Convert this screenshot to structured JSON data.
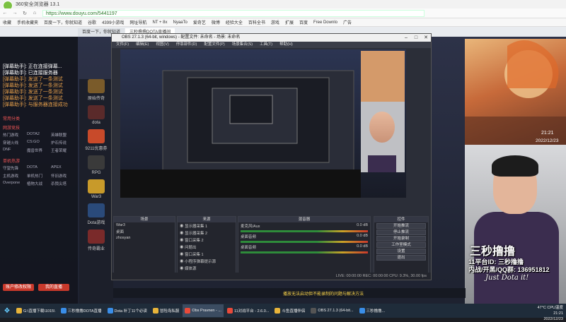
{
  "browser": {
    "title": "360安全浏览器 13.1",
    "url": "https://www.douyu.com/5441197",
    "bookmarks": [
      "收藏",
      "手机收藏夹",
      "百度一下，你就知道",
      "谷歌",
      "4399小游戏",
      "网址导航",
      "NT + 8x",
      "NyaaTo",
      "爱奇艺",
      "微博",
      "经验大全",
      "百科全书",
      "游戏",
      "扩展",
      "百度",
      "Free Downlo",
      "广告"
    ],
    "tabs": [
      {
        "label": "百度一下，你就知道",
        "active": false
      },
      {
        "label": "三秒撸撸DOTA直播间",
        "active": true
      }
    ]
  },
  "chat": {
    "lines": [
      {
        "text": "[弹幕助手]: 正在连接弹幕...",
        "white": true
      },
      {
        "text": "[弹幕助手]: 已连接服务器",
        "white": true
      },
      {
        "text": "[弹幕助手]: 发送了一条测试",
        "white": false
      },
      {
        "text": "[弹幕助手]: 发送了一条测试",
        "white": false
      },
      {
        "text": "[弹幕助手]: 发送了一条测试",
        "white": false
      },
      {
        "text": "[弹幕助手]: 发送了一条测试",
        "white": false
      },
      {
        "text": "[弹幕助手]: 与服务器连接成功",
        "white": false
      }
    ],
    "section_heads": [
      "常用分类",
      "网游竞技",
      "单机热游"
    ],
    "grid1": [
      "热门游戏",
      "DOTA2",
      "英雄联盟",
      "穿越火线",
      "CS:GO",
      "炉石传说",
      "DNF",
      "魔兽世界",
      "王者荣耀"
    ],
    "grid2": [
      "守望先锋",
      "DOTA",
      "APEX",
      "主机游戏",
      "单机热门",
      "怀旧游戏",
      "Overpone",
      "植物大战",
      "杀戮尖塔"
    ],
    "btn1": "账户修改权限",
    "btn2": "我的直播"
  },
  "games": [
    {
      "label": "原始传奇",
      "color": "#7a5b2a"
    },
    {
      "label": "dota",
      "color": "#5a2a2a"
    },
    {
      "label": "9211优惠券",
      "color": "#c84a2a"
    },
    {
      "label": "RPG",
      "color": "#3a3a3a"
    },
    {
      "label": "War3",
      "color": "#c89a2a"
    },
    {
      "label": "Dota游戏",
      "color": "#2a4a7a"
    },
    {
      "label": "传奇霸业",
      "color": "#7a2a2a"
    }
  ],
  "obs": {
    "title": "OBS 27.1.3 (64-bit, windows) - 配置文件: 未命名 - 场景: 未命名",
    "menu": [
      "文件(F)",
      "编辑(E)",
      "视图(V)",
      "停靠部件(D)",
      "配置文件(P)",
      "场景集合(S)",
      "工具(T)",
      "帮助(H)"
    ],
    "scenes_label": "场景",
    "scenes": [
      "War3",
      "桌面",
      "zhosyan"
    ],
    "sources_label": "来源",
    "sources": [
      "显示器采集 1",
      "显示器采集 2",
      "窗口采集 2",
      "问题出",
      "窗口采集 1",
      "小程序弹幕提示源",
      "媒体源"
    ],
    "mixer_label": "混音器",
    "mixer": [
      {
        "label": "麦克风/Aux",
        "db": "0.0 dB"
      },
      {
        "label": "桌面音频",
        "db": "0.0 dB"
      },
      {
        "label": "桌面音频",
        "db": "0.0 dB"
      }
    ],
    "controls_label": "控件",
    "controls": [
      "开始推流",
      "停止推流",
      "开始录制",
      "工作室模式",
      "设置",
      "退出"
    ],
    "status": "LIVE: 00:00:00  REC: 00:00:00  CPU: 9.3%, 30.00 fps",
    "preview_hint": "未选择源"
  },
  "streamer": {
    "name": "三秒撸撸",
    "room": "11平台ID: 三秒撸撸",
    "qq": "内战/开黑/QQ群: 136951812",
    "tagline": "Just Dota it!",
    "time": "21:21",
    "date": "2022/12/23"
  },
  "bottom": {
    "notice": "播放无法启动但不能录制的问题与解决方法"
  },
  "taskbar": {
    "items": [
      {
        "label": "G:\\直播下载\\1015\\",
        "color": "#e8b43a",
        "active": false
      },
      {
        "label": "三秒撸撸DOTA直播",
        "color": "#3a8ee8",
        "active": false
      },
      {
        "label": "Dota 补丁11个必读",
        "color": "#3a8ee8",
        "active": false
      },
      {
        "label": "冒险岛私服",
        "color": "#e8b43a",
        "active": false
      },
      {
        "label": "Obs Pravnen - ...",
        "color": "#e84a3a",
        "active": true
      },
      {
        "label": "11对战平台 - 2.6.0...",
        "color": "#e84a3a",
        "active": false
      },
      {
        "label": "斗鱼直播伴侣",
        "color": "#e8b43a",
        "active": false
      },
      {
        "label": "OBS 27.1.3 (64-bit...",
        "color": "#555",
        "active": false
      },
      {
        "label": "三秒撸撸...",
        "color": "#3a8ee8",
        "active": false
      }
    ],
    "tray_time": "21:21",
    "tray_date": "2022/12/23",
    "weather": "47°C CPU温度"
  }
}
